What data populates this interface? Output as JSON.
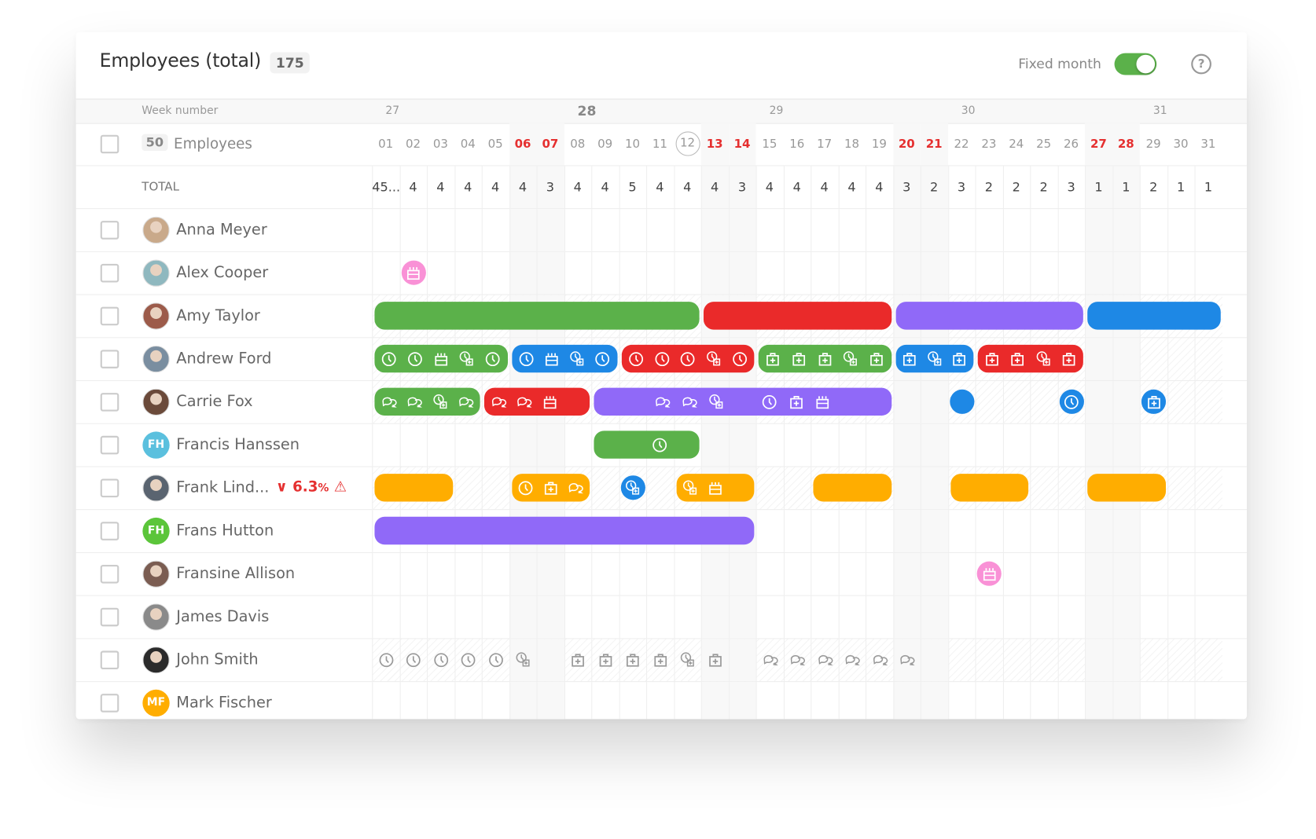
{
  "header": {
    "title": "Employees (total)",
    "total_count": "175",
    "fixed_month_label": "Fixed month",
    "fixed_month_on": true,
    "help_icon": "question-circle-icon"
  },
  "week_row": {
    "label": "Week number",
    "weeks": [
      {
        "number": "27",
        "start_day_index": 0,
        "current": false
      },
      {
        "number": "28",
        "start_day_index": 7,
        "current": true
      },
      {
        "number": "29",
        "start_day_index": 14,
        "current": false
      },
      {
        "number": "30",
        "start_day_index": 21,
        "current": false
      },
      {
        "number": "31",
        "start_day_index": 28,
        "current": false
      }
    ]
  },
  "employees_row": {
    "count": "50",
    "label": "Employees"
  },
  "days": [
    "01",
    "02",
    "03",
    "04",
    "05",
    "06",
    "07",
    "08",
    "09",
    "10",
    "11",
    "12",
    "13",
    "14",
    "15",
    "16",
    "17",
    "18",
    "19",
    "20",
    "21",
    "22",
    "23",
    "24",
    "25",
    "26",
    "27",
    "28",
    "29",
    "30",
    "31"
  ],
  "weekend_days": [
    "06",
    "07",
    "13",
    "14",
    "20",
    "21",
    "27",
    "28"
  ],
  "today": "12",
  "total_row": {
    "label": "TOTAL",
    "values": [
      "45...",
      "4",
      "4",
      "4",
      "4",
      "4",
      "3",
      "4",
      "4",
      "5",
      "4",
      "4",
      "4",
      "3",
      "4",
      "4",
      "4",
      "4",
      "4",
      "3",
      "2",
      "3",
      "2",
      "2",
      "2",
      "3",
      "1",
      "1",
      "2",
      "1",
      "1"
    ]
  },
  "colors": {
    "green": "#5bb14a",
    "red": "#ea2a2a",
    "purple": "#9069f8",
    "blue": "#1e88e5",
    "orange": "#ffad00",
    "pink": "#f991d6",
    "weekend_text": "#e53030"
  },
  "employees": [
    {
      "name": "Anna Meyer",
      "avatar": "photo",
      "avatar_color": "#c9a98a",
      "hatched": false,
      "events": []
    },
    {
      "name": "Alex Cooper",
      "avatar": "photo",
      "avatar_color": "#8fb8bf",
      "hatched": false,
      "events": [
        {
          "type": "dot",
          "color": "pink",
          "day": 2,
          "icons": [
            "cake"
          ]
        }
      ]
    },
    {
      "name": "Amy Taylor",
      "avatar": "photo",
      "avatar_color": "#9c5b4a",
      "hatched": true,
      "events": [
        {
          "type": "bar",
          "color": "green",
          "start": 1,
          "end": 12,
          "icons": []
        },
        {
          "type": "bar",
          "color": "red",
          "start": 13,
          "end": 19,
          "icons": []
        },
        {
          "type": "bar",
          "color": "purple",
          "start": 20,
          "end": 26,
          "icons": []
        },
        {
          "type": "bar",
          "color": "blue",
          "start": 27,
          "end": 31,
          "icons": []
        }
      ]
    },
    {
      "name": "Andrew Ford",
      "avatar": "photo",
      "avatar_color": "#7a8ea0",
      "hatched": true,
      "events": [
        {
          "type": "bar",
          "color": "green",
          "start": 1,
          "end": 5,
          "icons": [
            "clock",
            "clock",
            "cake",
            "clock-plus",
            "clock"
          ]
        },
        {
          "type": "bar",
          "color": "blue",
          "start": 6,
          "end": 9,
          "icons": [
            "clock",
            "cake",
            "clock-plus",
            "clock"
          ]
        },
        {
          "type": "bar",
          "color": "red",
          "start": 10,
          "end": 14,
          "icons": [
            "clock",
            "clock",
            "clock",
            "clock-plus",
            "clock"
          ]
        },
        {
          "type": "bar",
          "color": "green",
          "start": 15,
          "end": 19,
          "icons": [
            "medkit",
            "medkit",
            "medkit",
            "clock-plus",
            "medkit"
          ]
        },
        {
          "type": "bar",
          "color": "blue",
          "start": 20,
          "end": 22,
          "icons": [
            "medkit",
            "clock-plus",
            "medkit"
          ]
        },
        {
          "type": "bar",
          "color": "red",
          "start": 23,
          "end": 26,
          "icons": [
            "medkit",
            "medkit",
            "clock-plus",
            "medkit"
          ]
        }
      ]
    },
    {
      "name": "Carrie Fox",
      "avatar": "photo",
      "avatar_color": "#6b4a3a",
      "hatched": true,
      "events": [
        {
          "type": "bar",
          "color": "green",
          "start": 1,
          "end": 4,
          "icons": [
            "chat",
            "chat",
            "clock-plus",
            "chat"
          ]
        },
        {
          "type": "bar",
          "color": "red",
          "start": 5,
          "end": 8,
          "icons": [
            "chat",
            "chat",
            "cake",
            ""
          ]
        },
        {
          "type": "bar",
          "color": "purple",
          "start": 9,
          "end": 19,
          "icons": [
            "",
            "",
            "chat",
            "chat",
            "clock-plus",
            "",
            "clock",
            "medkit",
            "cake",
            "",
            ""
          ]
        },
        {
          "type": "dot",
          "color": "blue",
          "day": 22,
          "icons": []
        },
        {
          "type": "dot",
          "color": "blue",
          "day": 26,
          "icons": [
            "clock"
          ]
        },
        {
          "type": "dot",
          "color": "blue",
          "day": 29,
          "icons": [
            "medkit"
          ]
        }
      ]
    },
    {
      "name": "Francis Hanssen",
      "avatar": "initials",
      "initials": "FH",
      "avatar_color": "#5bc0de",
      "hatched": false,
      "events": [
        {
          "type": "bar",
          "color": "green",
          "start": 9,
          "end": 12,
          "icons": [
            "",
            "",
            "clock",
            ""
          ]
        }
      ]
    },
    {
      "name": "Frank Lind...",
      "avatar": "photo",
      "avatar_color": "#5a6470",
      "hatched": true,
      "warning": {
        "value": "6.3",
        "unit": "%",
        "trend": "down"
      },
      "events": [
        {
          "type": "bar",
          "color": "orange",
          "start": 1,
          "end": 3,
          "icons": []
        },
        {
          "type": "bar",
          "color": "orange",
          "start": 6,
          "end": 8,
          "icons": [
            "clock",
            "medkit",
            "chat"
          ]
        },
        {
          "type": "dot",
          "color": "blue",
          "day": 10,
          "icons": [
            "clock-plus"
          ]
        },
        {
          "type": "bar",
          "color": "orange",
          "start": 12,
          "end": 14,
          "icons": [
            "clock-plus",
            "cake",
            ""
          ]
        },
        {
          "type": "bar",
          "color": "orange",
          "start": 17,
          "end": 19,
          "icons": []
        },
        {
          "type": "bar",
          "color": "orange",
          "start": 22,
          "end": 24,
          "icons": []
        },
        {
          "type": "bar",
          "color": "orange",
          "start": 27,
          "end": 29,
          "icons": []
        }
      ]
    },
    {
      "name": "Frans Hutton",
      "avatar": "initials",
      "initials": "FH",
      "avatar_color": "#5bc53a",
      "hatched": false,
      "events": [
        {
          "type": "bar",
          "color": "purple",
          "start": 1,
          "end": 14,
          "icons": []
        }
      ]
    },
    {
      "name": "Fransine Allison",
      "avatar": "photo",
      "avatar_color": "#7b5d52",
      "hatched": false,
      "events": [
        {
          "type": "dot",
          "color": "pink",
          "day": 23,
          "icons": [
            "cake"
          ]
        }
      ]
    },
    {
      "name": "James Davis",
      "avatar": "photo",
      "avatar_color": "#8a8a8a",
      "hatched": false,
      "events": []
    },
    {
      "name": "John Smith",
      "avatar": "photo",
      "avatar_color": "#2b2b2b",
      "hatched": true,
      "events": [
        {
          "type": "ghost",
          "day": 1,
          "icons": [
            "clock"
          ]
        },
        {
          "type": "ghost",
          "day": 2,
          "icons": [
            "clock"
          ]
        },
        {
          "type": "ghost",
          "day": 3,
          "icons": [
            "clock"
          ]
        },
        {
          "type": "ghost",
          "day": 4,
          "icons": [
            "clock"
          ]
        },
        {
          "type": "ghost",
          "day": 5,
          "icons": [
            "clock"
          ]
        },
        {
          "type": "ghost",
          "day": 6,
          "icons": [
            "clock-plus"
          ]
        },
        {
          "type": "ghost",
          "day": 8,
          "icons": [
            "medkit"
          ]
        },
        {
          "type": "ghost",
          "day": 9,
          "icons": [
            "medkit"
          ]
        },
        {
          "type": "ghost",
          "day": 10,
          "icons": [
            "medkit"
          ]
        },
        {
          "type": "ghost",
          "day": 11,
          "icons": [
            "medkit"
          ]
        },
        {
          "type": "ghost",
          "day": 12,
          "icons": [
            "clock-plus"
          ]
        },
        {
          "type": "ghost",
          "day": 13,
          "icons": [
            "medkit"
          ]
        },
        {
          "type": "ghost",
          "day": 15,
          "icons": [
            "chat"
          ]
        },
        {
          "type": "ghost",
          "day": 16,
          "icons": [
            "chat"
          ]
        },
        {
          "type": "ghost",
          "day": 17,
          "icons": [
            "chat"
          ]
        },
        {
          "type": "ghost",
          "day": 18,
          "icons": [
            "chat"
          ]
        },
        {
          "type": "ghost",
          "day": 19,
          "icons": [
            "chat"
          ]
        },
        {
          "type": "ghost",
          "day": 20,
          "icons": [
            "chat"
          ]
        }
      ]
    },
    {
      "name": "Mark Fischer",
      "avatar": "initials",
      "initials": "MF",
      "avatar_color": "#ffad00",
      "hatched": false,
      "events": []
    }
  ]
}
